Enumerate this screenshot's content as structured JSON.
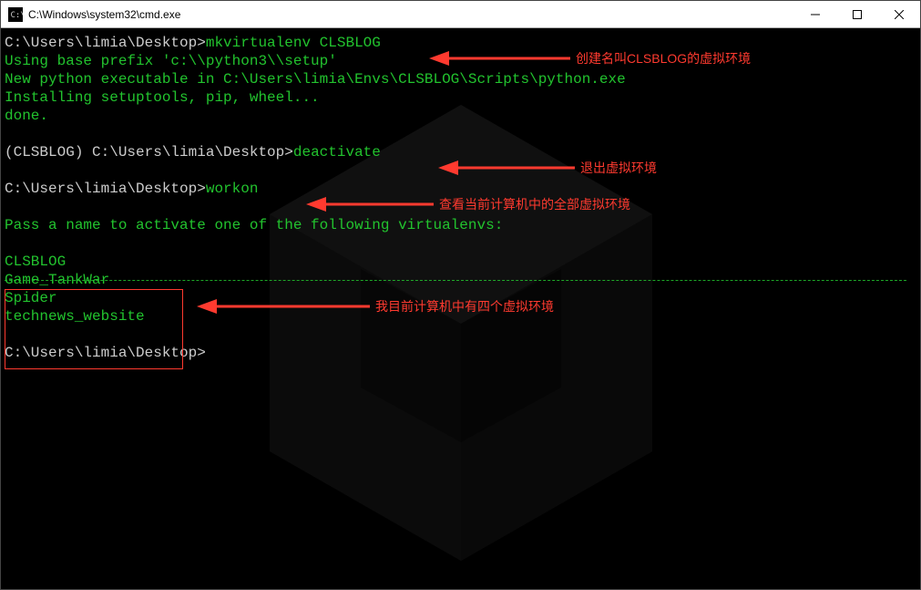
{
  "window": {
    "title": "C:\\Windows\\system32\\cmd.exe",
    "icon": "cmd-icon"
  },
  "controls": {
    "minimize_label": "─",
    "maximize_label": "☐",
    "close_label": "✕"
  },
  "terminal": {
    "prompt1": "C:\\Users\\limia\\Desktop>",
    "cmd1": "mkvirtualenv CLSBLOG",
    "line_base_prefix": "Using base prefix 'c:\\\\python3\\\\setup'",
    "line_new_exec": "New python executable in C:\\Users\\limia\\Envs\\CLSBLOG\\Scripts\\python.exe",
    "line_installing": "Installing setuptools, pip, wheel...",
    "line_done": "done.",
    "prompt2": "(CLSBLOG) C:\\Users\\limia\\Desktop>",
    "cmd2": "deactivate",
    "prompt3": "C:\\Users\\limia\\Desktop>",
    "cmd3": "workon",
    "line_passaname": "Pass a name to activate one of the following virtualenvs:",
    "envs": [
      "CLSBLOG",
      "Game_TankWar",
      "Spider",
      "technews_website"
    ],
    "prompt4": "C:\\Users\\limia\\Desktop>"
  },
  "annotations": {
    "create_env": "创建名叫CLSBLOG的虚拟环境",
    "deactivate": "退出虚拟环境",
    "workon": "查看当前计算机中的全部虚拟环境",
    "envs_note": "我目前计算机中有四个虚拟环境"
  },
  "colors": {
    "term_green": "#22c32e",
    "term_white": "#cccccc",
    "annot_red": "#ff3a2f",
    "bg_black": "#000000"
  }
}
